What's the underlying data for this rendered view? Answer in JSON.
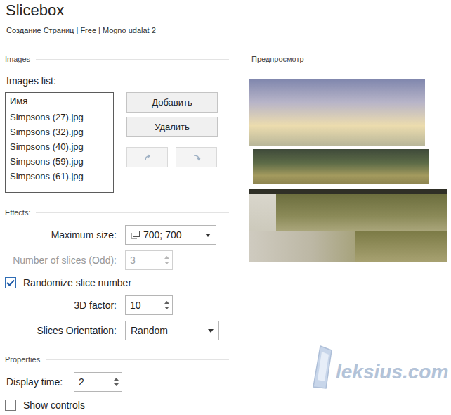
{
  "window": {
    "title": "Slicebox",
    "subtitle": "Создание Страниц | Free | Mogno udalat 2"
  },
  "images": {
    "section": "Images",
    "list_label": "Images list:",
    "column": "Имя",
    "items": [
      "Simpsons (27).jpg",
      "Simpsons (32).jpg",
      "Simpsons (40).jpg",
      "Simpsons (59).jpg",
      "Simpsons (61).jpg"
    ],
    "buttons": [
      {
        "label": "Добавить"
      },
      {
        "label": "Удалить"
      }
    ],
    "move_buttons": [
      {
        "kind": "up",
        "disabled": true
      },
      {
        "kind": "down",
        "disabled": true
      }
    ]
  },
  "effects": {
    "section": "Effects:",
    "fields": [
      {
        "kind": "size-dropdown",
        "label": "Maximum size:",
        "value": "700; 700",
        "disabled": false
      },
      {
        "kind": "spinner",
        "label": "Number of slices (Odd):",
        "value": "3",
        "disabled": true
      },
      {
        "kind": "checkbox",
        "label": "Randomize slice number",
        "checked": true
      },
      {
        "kind": "spinner",
        "label": "3D factor:",
        "value": "10",
        "disabled": false
      },
      {
        "kind": "dropdown",
        "label": "Slices Orientation:",
        "value": "Random",
        "disabled": false
      }
    ]
  },
  "properties": {
    "section": "Properties",
    "fields": [
      {
        "kind": "spinner",
        "label": "Display time:",
        "value": "2",
        "disabled": false
      },
      {
        "kind": "checkbox",
        "label": "Show controls",
        "checked": false
      }
    ]
  },
  "preview": {
    "title": "Предпросмотр"
  },
  "watermark": {
    "text": "leksius.com"
  }
}
